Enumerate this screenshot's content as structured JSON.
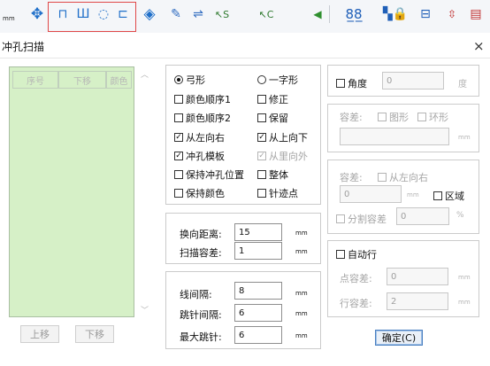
{
  "toolbar": {
    "unit": "mm",
    "icons": [
      "move-arrows-icon",
      "punch-step-icon",
      "punch-row-icon",
      "punch-round-icon",
      "punch-rect-icon",
      "expand-icon",
      "feather-icon",
      "swap-icon",
      "select-s-icon",
      "select-c-icon",
      "triangle-left-icon",
      "chain-icon",
      "lock-icon",
      "insert-icon",
      "letter-icon",
      "palette-icon",
      "more-icon"
    ]
  },
  "dialog": {
    "title": "冲孔扫描",
    "close": "×",
    "list": {
      "headers": [
        "序号",
        "下移",
        "颜色"
      ],
      "up_button": "上移",
      "down_button": "下移"
    },
    "options": {
      "radio_bow": "弓形",
      "radio_bow_selected": true,
      "radio_line": "一字形",
      "radio_line_selected": false,
      "color_order_1": "颜色顺序1",
      "color_order_1_checked": false,
      "correct": "修正",
      "correct_checked": false,
      "color_order_2": "颜色顺序2",
      "color_order_2_checked": false,
      "keep": "保留",
      "keep_checked": false,
      "left_to_right": "从左向右",
      "left_to_right_checked": true,
      "top_to_bottom": "从上向下",
      "top_to_bottom_checked": true,
      "punch_template": "冲孔模板",
      "punch_template_checked": true,
      "inside_out": "从里向外",
      "inside_out_checked": true,
      "keep_punch_pos": "保持冲孔位置",
      "keep_punch_pos_checked": false,
      "whole": "整体",
      "whole_checked": false,
      "keep_color": "保持颜色",
      "keep_color_checked": false,
      "stitch_point": "针迹点",
      "stitch_point_checked": false
    },
    "scan": {
      "turn_distance_label": "换向距离:",
      "turn_distance": "15",
      "scan_tolerance_label": "扫描容差:",
      "scan_tolerance": "1",
      "unit": "mm"
    },
    "line": {
      "line_spacing_label": "线间隔:",
      "line_spacing": "8",
      "jump_spacing_label": "跳针间隔:",
      "jump_spacing": "6",
      "max_jump_label": "最大跳针:",
      "max_jump": "6",
      "unit": "mm"
    },
    "angle": {
      "label": "角度",
      "checked": false,
      "value": "0",
      "unit": "度"
    },
    "tolerance_shape": {
      "label": "容差:",
      "graph": "图形",
      "ring": "环形",
      "unit": "mm"
    },
    "tolerance_dir": {
      "label": "容差:",
      "left_to_right": "从左向右",
      "value": "0",
      "unit": "mm",
      "region": "区域",
      "region_checked": false,
      "split_tolerance": "分割容差",
      "split_value": "0",
      "percent": "%"
    },
    "auto_line": {
      "label": "自动行",
      "checked": false,
      "point_tol_label": "点容差:",
      "point_tol": "0",
      "line_tol_label": "行容差:",
      "line_tol": "2",
      "unit": "mm"
    },
    "ok_button": "确定(C)"
  }
}
